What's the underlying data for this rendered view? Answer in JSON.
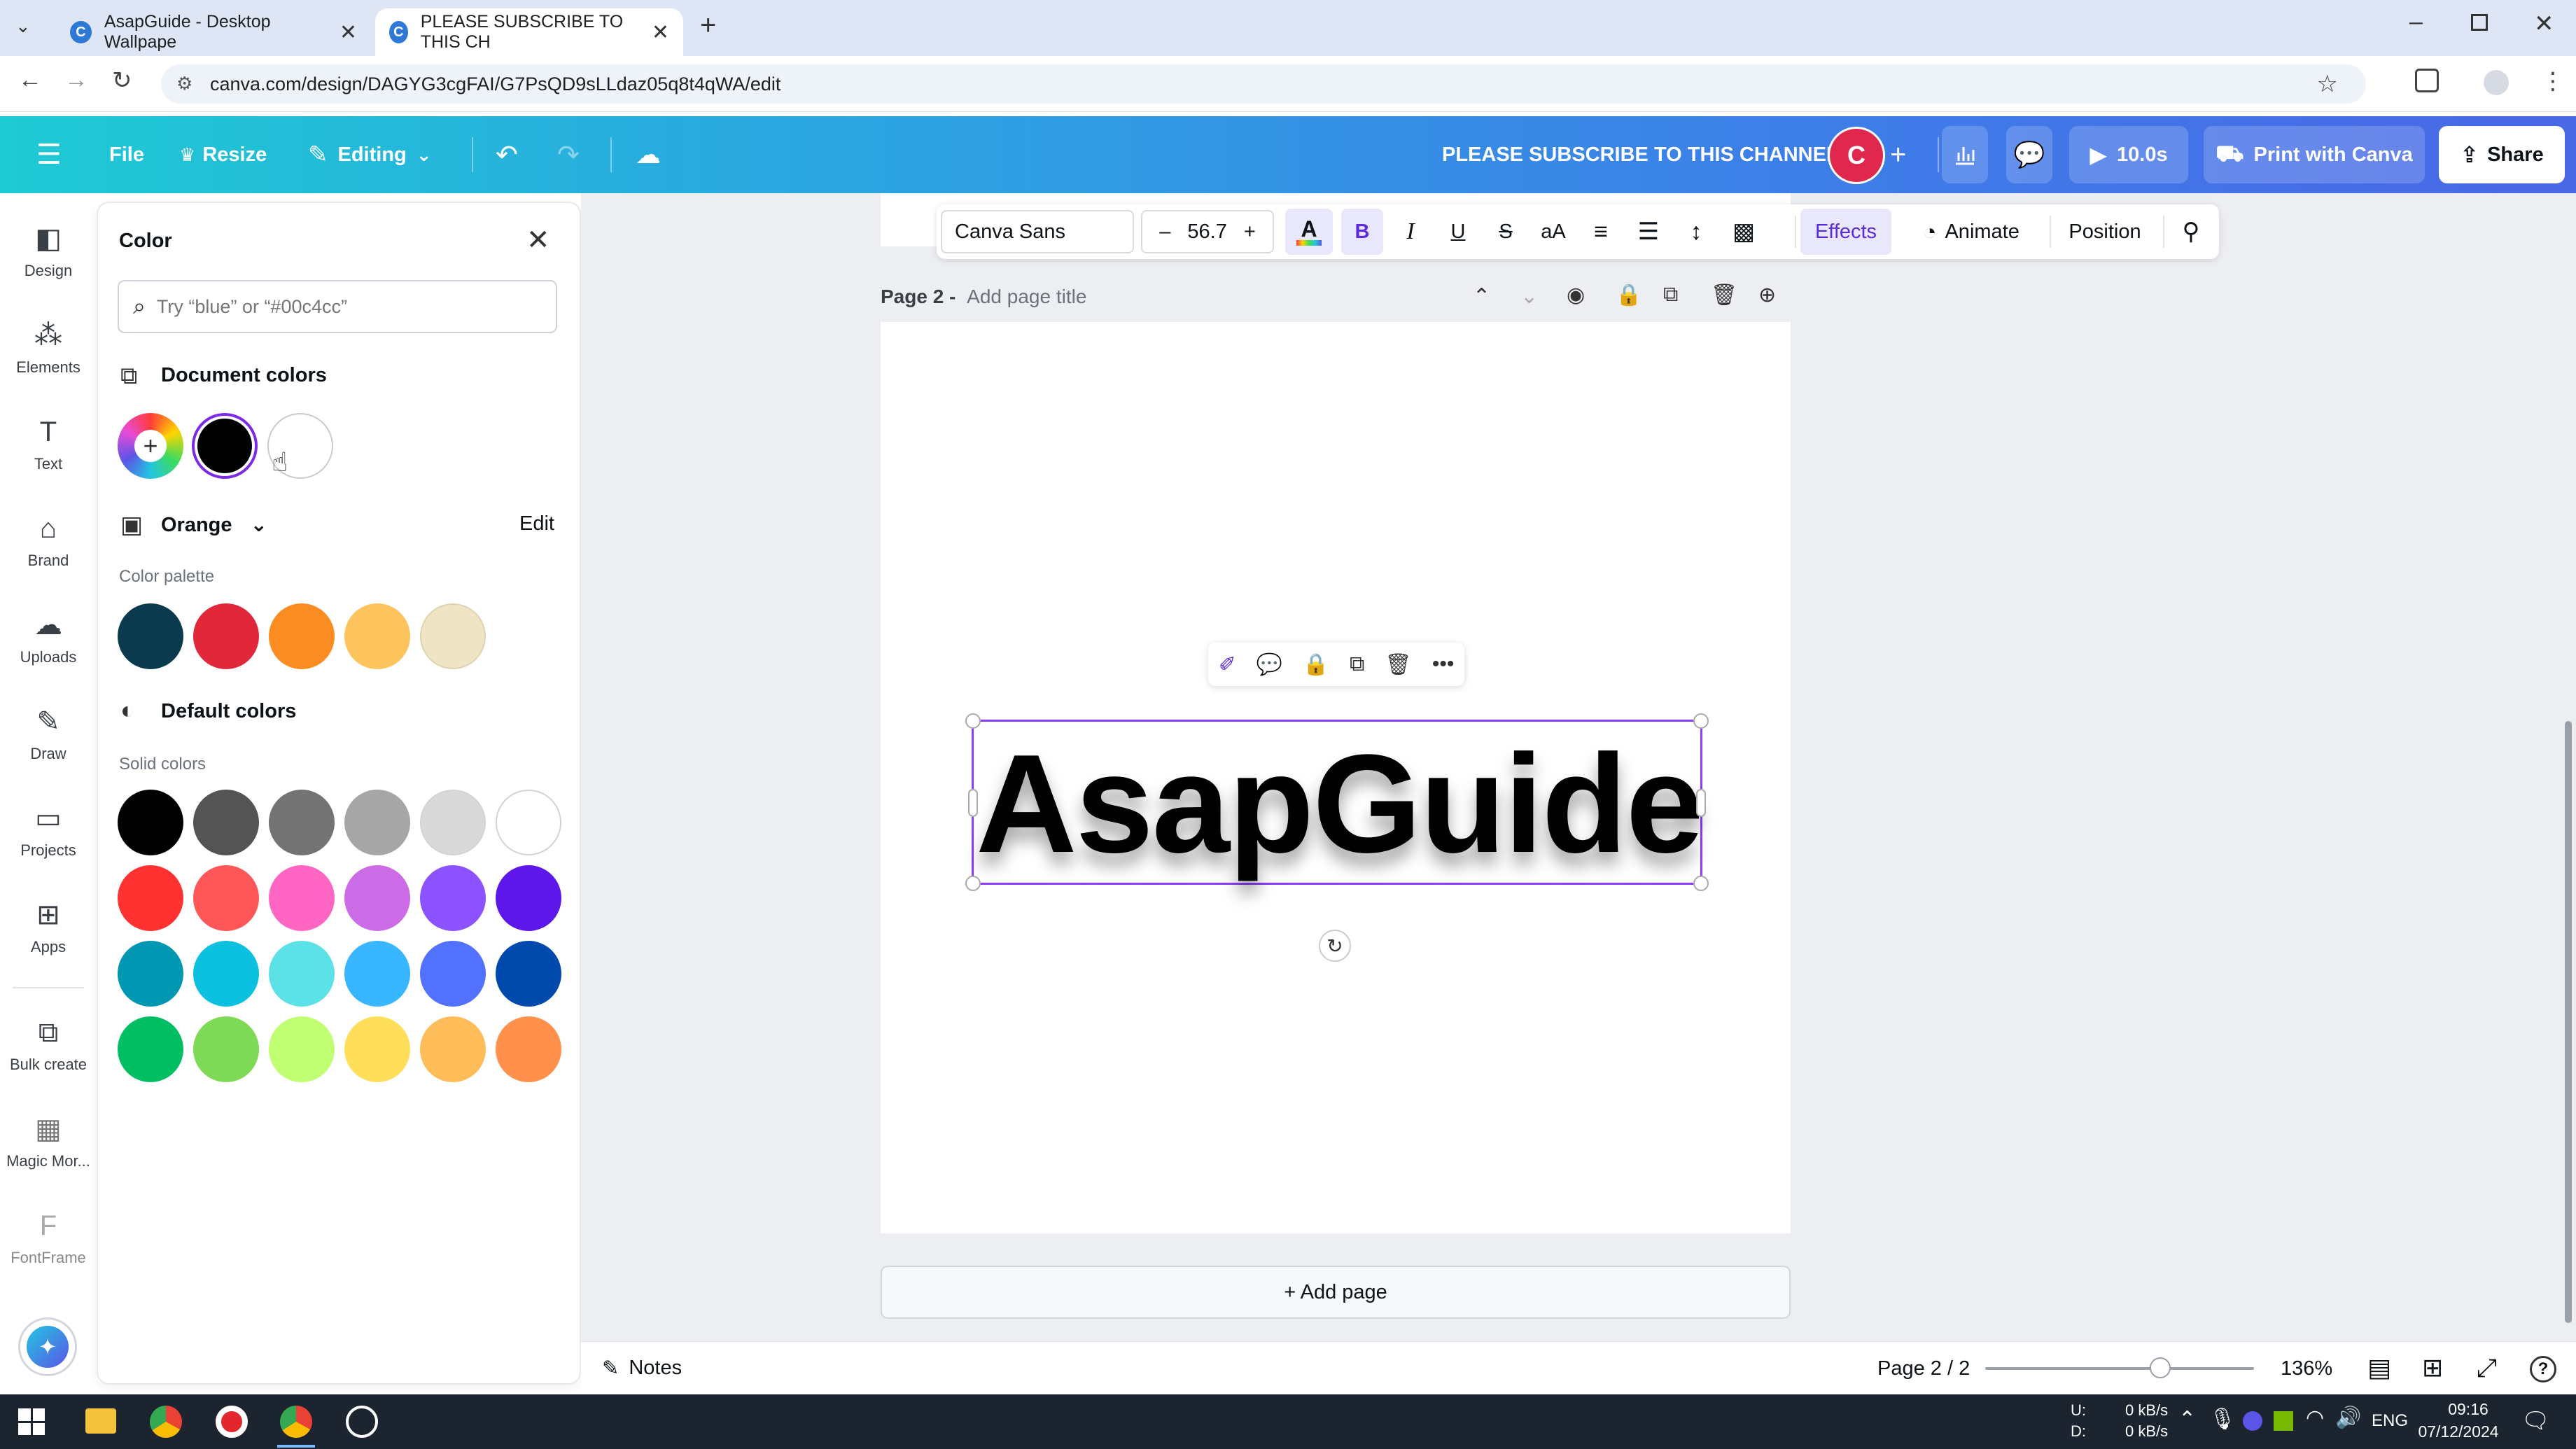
{
  "browser": {
    "tabs": [
      {
        "title": "AsapGuide - Desktop Wallpape"
      },
      {
        "title": "PLEASE SUBSCRIBE TO THIS CH"
      }
    ],
    "url": "canva.com/design/DAGYG3cgFAI/G7PsQD9sLLdaz05q8t4qWA/edit"
  },
  "header": {
    "file": "File",
    "resize": "Resize",
    "editing": "Editing",
    "title": "PLEASE SUBSCRIBE TO THIS CHANNEL",
    "avatar": "C",
    "timer": "10.0s",
    "print": "Print with Canva",
    "share": "Share"
  },
  "rail": [
    {
      "label": "Design",
      "icon": "design-icon"
    },
    {
      "label": "Elements",
      "icon": "elements-icon"
    },
    {
      "label": "Text",
      "icon": "text-icon"
    },
    {
      "label": "Brand",
      "icon": "brand-icon"
    },
    {
      "label": "Uploads",
      "icon": "uploads-icon"
    },
    {
      "label": "Draw",
      "icon": "draw-icon"
    },
    {
      "label": "Projects",
      "icon": "projects-icon"
    },
    {
      "label": "Apps",
      "icon": "apps-icon"
    },
    {
      "label": "Bulk create",
      "icon": "bulk-create-icon"
    },
    {
      "label": "Magic Mor...",
      "icon": "magic-morph-icon"
    },
    {
      "label": "FontFrame",
      "icon": "fontframe-icon"
    }
  ],
  "panel": {
    "title": "Color",
    "search_placeholder": "Try “blue” or “#00c4cc”",
    "document_colors_label": "Document colors",
    "document_colors": [
      "#000000",
      "#ffffff"
    ],
    "palette_name": "Orange",
    "edit_label": "Edit",
    "palette_label": "Color palette",
    "palette_colors": [
      "#0b3a4f",
      "#e0283a",
      "#fb8c22",
      "#fdc35d",
      "#efe5c4"
    ],
    "default_colors_label": "Default colors",
    "solid_label": "Solid colors",
    "solid_colors": [
      "#000000",
      "#545454",
      "#737373",
      "#a6a6a6",
      "#d9d9d9",
      "#ffffff",
      "#ff3131",
      "#ff5757",
      "#ff66c4",
      "#cb6ce6",
      "#8c52ff",
      "#5e17eb",
      "#0097b2",
      "#0cc0df",
      "#5ce1e6",
      "#38b6ff",
      "#5271ff",
      "#004aad",
      "#00bf63",
      "#7ed957",
      "#c1ff72",
      "#ffde59",
      "#ffbd59",
      "#ff914d"
    ]
  },
  "toolbar": {
    "font": "Canva Sans",
    "size": "56.7",
    "effects": "Effects",
    "animate": "Animate",
    "position": "Position"
  },
  "canvas": {
    "page_label": "Page 2 -",
    "page_title_placeholder": "Add page title",
    "text": "AsapGuide",
    "add_page": "+ Add page"
  },
  "footer": {
    "notes": "Notes",
    "page_count": "Page 2 / 2",
    "zoom": "136%",
    "zoom_level": 0.65
  },
  "taskbar": {
    "net_up": "0 kB/s",
    "net_down": "0 kB/s",
    "up_label": "U:",
    "down_label": "D:",
    "lang": "ENG",
    "time": "09:16",
    "date": "07/12/2024"
  }
}
